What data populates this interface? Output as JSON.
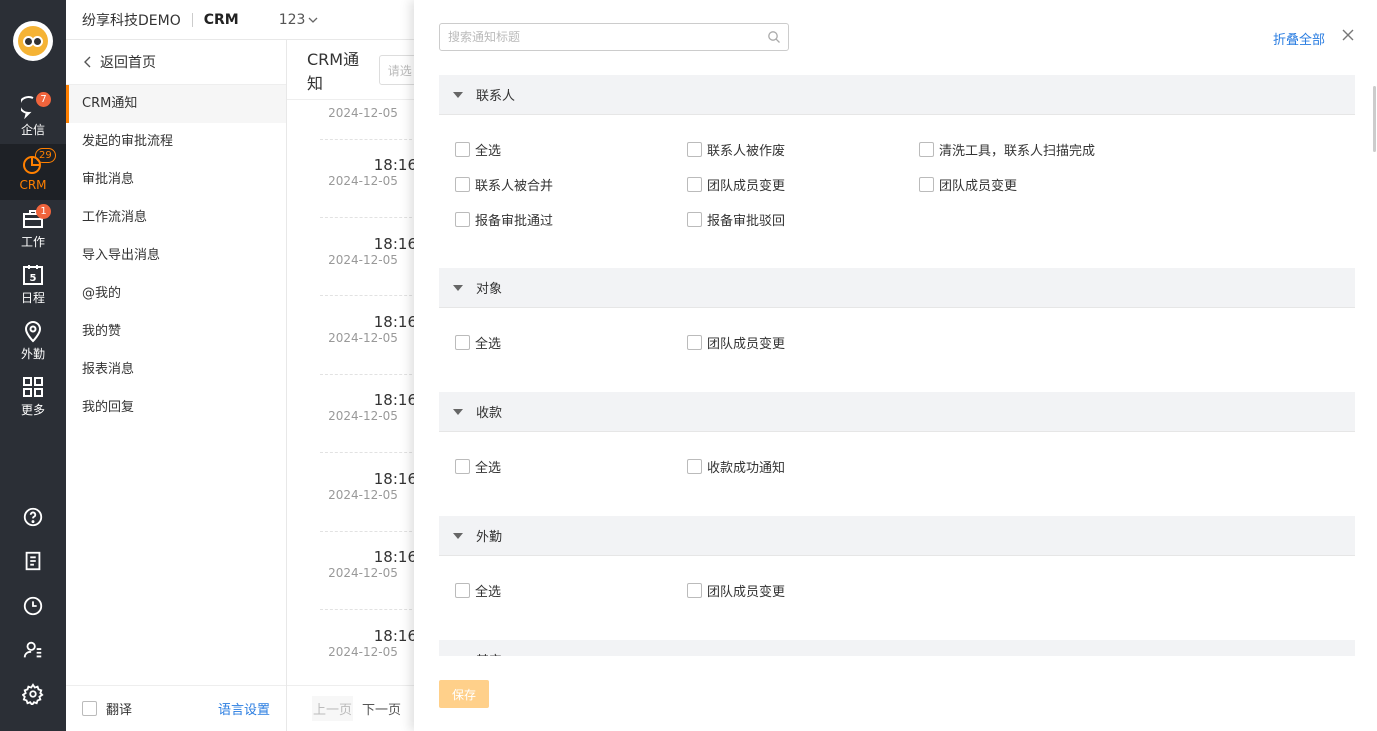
{
  "rail": {
    "items": [
      {
        "label": "企信",
        "icon": "chat-bubble-icon",
        "badge": "7"
      },
      {
        "label": "CRM",
        "icon": "pie-chart-icon",
        "badge": "29"
      },
      {
        "label": "工作",
        "icon": "briefcase-icon",
        "badge": "1"
      },
      {
        "label": "日程",
        "icon": "calendar-icon",
        "calendar_day": "5"
      },
      {
        "label": "外勤",
        "icon": "location-pin-icon"
      },
      {
        "label": "更多",
        "icon": "grid-icon"
      }
    ],
    "bottom_icons": [
      "help-icon",
      "document-icon",
      "clock-icon",
      "contacts-icon",
      "settings-icon"
    ]
  },
  "header": {
    "company": "纷享科技DEMO",
    "app": "CRM",
    "user": "123"
  },
  "menu": {
    "back_label": "返回首页",
    "items": [
      "CRM通知",
      "发起的审批流程",
      "审批消息",
      "工作流消息",
      "导入导出消息",
      "@我的",
      "我的赞",
      "报表消息",
      "我的回复"
    ],
    "active_index": 0,
    "translate_label": "翻译",
    "lang_settings_label": "语言设置"
  },
  "list": {
    "title": "CRM通知",
    "search_placeholder_fragment": "请选",
    "entries": [
      {
        "time": "",
        "date": "2024-12-05"
      },
      {
        "time": "18:16",
        "date": "2024-12-05"
      },
      {
        "time": "18:16",
        "date": "2024-12-05"
      },
      {
        "time": "18:16",
        "date": "2024-12-05"
      },
      {
        "time": "18:16",
        "date": "2024-12-05"
      },
      {
        "time": "18:16",
        "date": "2024-12-05"
      },
      {
        "time": "18:16",
        "date": "2024-12-05"
      },
      {
        "time": "18:16",
        "date": "2024-12-05"
      }
    ],
    "prev_label": "上一页",
    "next_label": "下一页"
  },
  "drawer": {
    "search_placeholder": "搜索通知标题",
    "collapse_all": "折叠全部",
    "save_label": "保存",
    "sections": [
      {
        "title": "联系人",
        "options": [
          "全选",
          "联系人被作废",
          "清洗工具，联系人扫描完成",
          "联系人被合并",
          "团队成员变更",
          "团队成员变更",
          "报备审批通过",
          "报备审批驳回"
        ]
      },
      {
        "title": "对象",
        "options": [
          "全选",
          "团队成员变更"
        ]
      },
      {
        "title": "收款",
        "options": [
          "全选",
          "收款成功通知"
        ]
      },
      {
        "title": "外勤",
        "options": [
          "全选",
          "团队成员变更"
        ]
      },
      {
        "title": "其它",
        "options": []
      }
    ]
  },
  "colors": {
    "accent": "#ff8000",
    "link": "#2a7de1",
    "rail_bg": "#2b2f36",
    "badge": "#f0643c",
    "save_disabled": "#ffd08a"
  }
}
